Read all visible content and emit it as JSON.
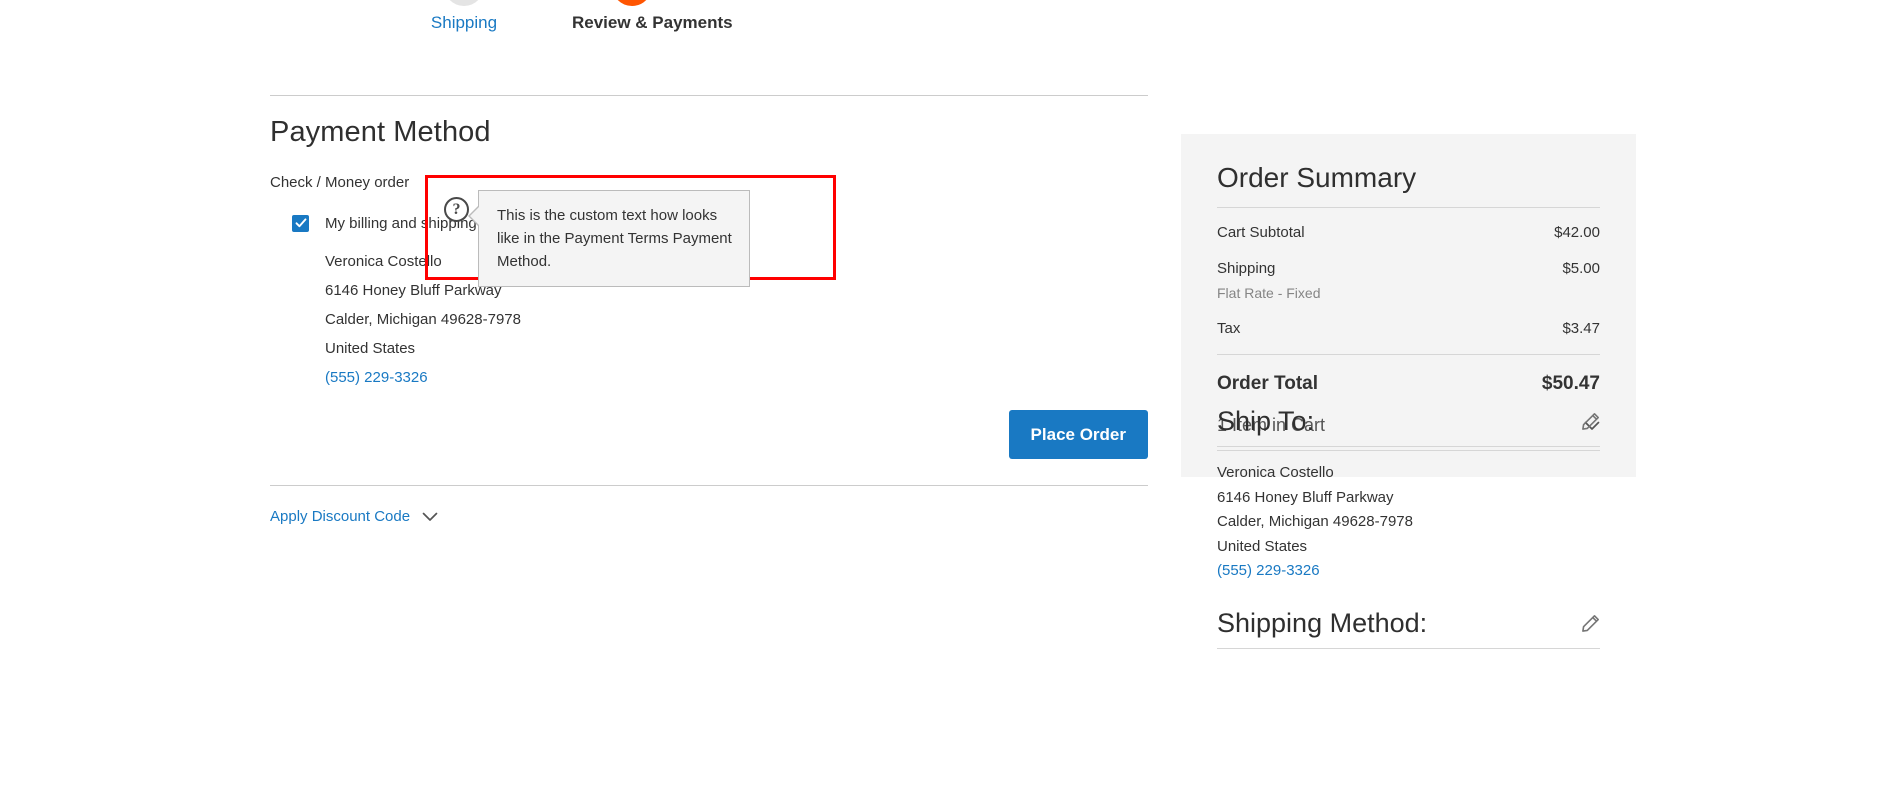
{
  "checkout": {
    "steps": [
      {
        "label": "Shipping",
        "state": "completed"
      },
      {
        "label": "Review & Payments",
        "state": "active"
      }
    ]
  },
  "payment": {
    "section_title": "Payment Method",
    "method_name": "Check / Money order",
    "help_icon_glyph": "?",
    "tooltip_text": "This is the custom text how looks like in the Payment Terms Payment Method.",
    "same_address_label": "My billing and shipping address are the same",
    "billing_address": {
      "name": "Veronica Costello",
      "street": "6146 Honey Bluff Parkway",
      "city_state_zip": "Calder, Michigan 49628-7978",
      "country": "United States",
      "phone": "(555) 229-3326"
    },
    "place_order_label": "Place Order",
    "discount_label": "Apply Discount Code"
  },
  "order_summary": {
    "title": "Order Summary",
    "rows": [
      {
        "label": "Cart Subtotal",
        "sublabel": "",
        "value": "$42.00"
      },
      {
        "label": "Shipping",
        "sublabel": "Flat Rate - Fixed",
        "value": "$5.00"
      },
      {
        "label": "Tax",
        "sublabel": "",
        "value": "$3.47"
      }
    ],
    "total_label": "Order Total",
    "total_value": "$50.47",
    "items_in_cart": "1 Item in Cart"
  },
  "ship_to": {
    "title": "Ship To:",
    "address": {
      "name": "Veronica Costello",
      "street": "6146 Honey Bluff Parkway",
      "city_state_zip": "Calder, Michigan 49628-7978",
      "country": "United States",
      "phone": "(555) 229-3326"
    }
  },
  "shipping_method": {
    "title": "Shipping Method:"
  },
  "colors": {
    "accent_orange": "#ff5501",
    "link_blue": "#1979c3",
    "button_blue": "#1979c3",
    "highlight_red": "#ff0000",
    "panel_gray": "#f4f4f4"
  }
}
